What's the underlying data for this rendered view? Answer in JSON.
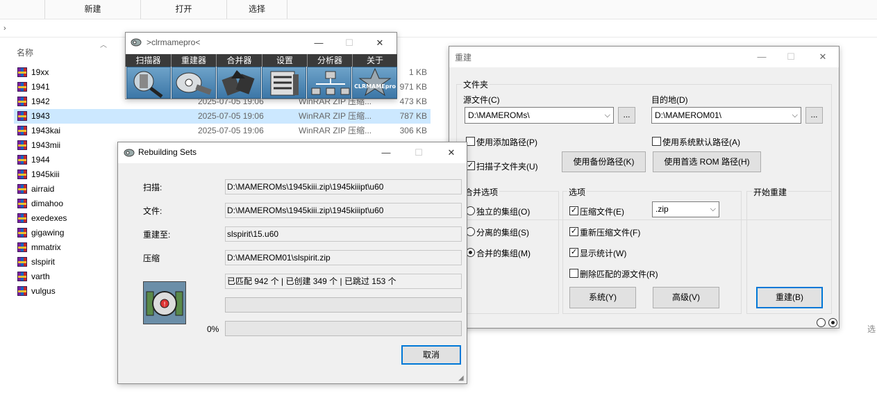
{
  "explorer": {
    "toolbar": [
      "新建",
      "打开",
      "选择"
    ],
    "column_name": "名称",
    "files": [
      {
        "name": "19xx",
        "date": "",
        "type": "",
        "size": "1 KB"
      },
      {
        "name": "1941",
        "date": "",
        "type": "",
        "size": "971 KB"
      },
      {
        "name": "1942",
        "date": "2025-07-05 19:06",
        "type": "WinRAR ZIP 压缩...",
        "size": "473 KB"
      },
      {
        "name": "1943",
        "date": "2025-07-05 19:06",
        "type": "WinRAR ZIP 压缩...",
        "size": "787 KB"
      },
      {
        "name": "1943kai",
        "date": "2025-07-05 19:06",
        "type": "WinRAR ZIP 压缩...",
        "size": "306 KB"
      },
      {
        "name": "1943mii",
        "date": "",
        "type": "",
        "size": ""
      },
      {
        "name": "1944",
        "date": "",
        "type": "",
        "size": ""
      },
      {
        "name": "1945kiii",
        "date": "",
        "type": "",
        "size": ""
      },
      {
        "name": "airraid",
        "date": "",
        "type": "",
        "size": ""
      },
      {
        "name": "dimahoo",
        "date": "",
        "type": "",
        "size": ""
      },
      {
        "name": "exedexes",
        "date": "",
        "type": "",
        "size": ""
      },
      {
        "name": "gigawing",
        "date": "",
        "type": "",
        "size": ""
      },
      {
        "name": "mmatrix",
        "date": "",
        "type": "",
        "size": ""
      },
      {
        "name": "slspirit",
        "date": "",
        "type": "",
        "size": ""
      },
      {
        "name": "varth",
        "date": "",
        "type": "",
        "size": ""
      },
      {
        "name": "vulgus",
        "date": "",
        "type": "",
        "size": ""
      }
    ],
    "right_edge_text": "选"
  },
  "clrmamepro": {
    "title": ">clrmamepro<",
    "menu": [
      "扫描器",
      "重建器",
      "合并器",
      "设置",
      "分析器",
      "关于"
    ],
    "icons": [
      "scanner-icon",
      "rebuilder-icon",
      "merger-icon",
      "settings-icon",
      "analyzer-icon",
      "clrmamepro-logo-icon"
    ],
    "logo_text": "CLRMAMEpro"
  },
  "rebuild": {
    "title": "重建",
    "files_group": "文件夹",
    "source_label": "源文件(C)",
    "source_value": "D:\\MAMEROMs\\",
    "dest_label": "目的地(D)",
    "dest_value": "D:\\MAMEROM01\\",
    "browse": "...",
    "use_add_path": "使用添加路径(P)",
    "scan_subfolders": "扫描子文件夹(U)",
    "use_backup_path": "使用备份路径(K)",
    "use_system_default": "使用系统默认路径(A)",
    "use_preferred_rom": "使用首选 ROM 路径(H)",
    "merge_group": "合并选项",
    "merge_options": [
      "独立的集组(O)",
      "分离的集组(S)",
      "合并的集组(M)"
    ],
    "options_group": "选项",
    "compress": "压缩文件(E)",
    "recompress": "重新压缩文件(F)",
    "show_stats": "显示统计(W)",
    "delete_matched": "删除匹配的源文件(R)",
    "archive_format": ".zip",
    "system_button": "系统(Y)",
    "advanced_button": "高级(V)",
    "start_group": "开始重建",
    "rebuild_button": "重建(B)"
  },
  "progress": {
    "title": "Rebuilding Sets",
    "scan_label": "扫描:",
    "scan_value": "D:\\MAMEROMs\\1945kiii.zip\\1945kiiipt\\u60",
    "file_label": "文件:",
    "file_value": "D:\\MAMEROMs\\1945kiii.zip\\1945kiiipt\\u60",
    "rebuild_to_label": "重建至:",
    "rebuild_to_value": "slspirit\\15.u60",
    "compress_label": "压缩",
    "compress_value": "D:\\MAMEROM01\\slspirit.zip",
    "stats": "已匹配 942 个 | 已创建 349 个 | 已跳过 153 个",
    "percent_label": "0%",
    "progress_fraction": 0,
    "cancel_button": "取消"
  }
}
